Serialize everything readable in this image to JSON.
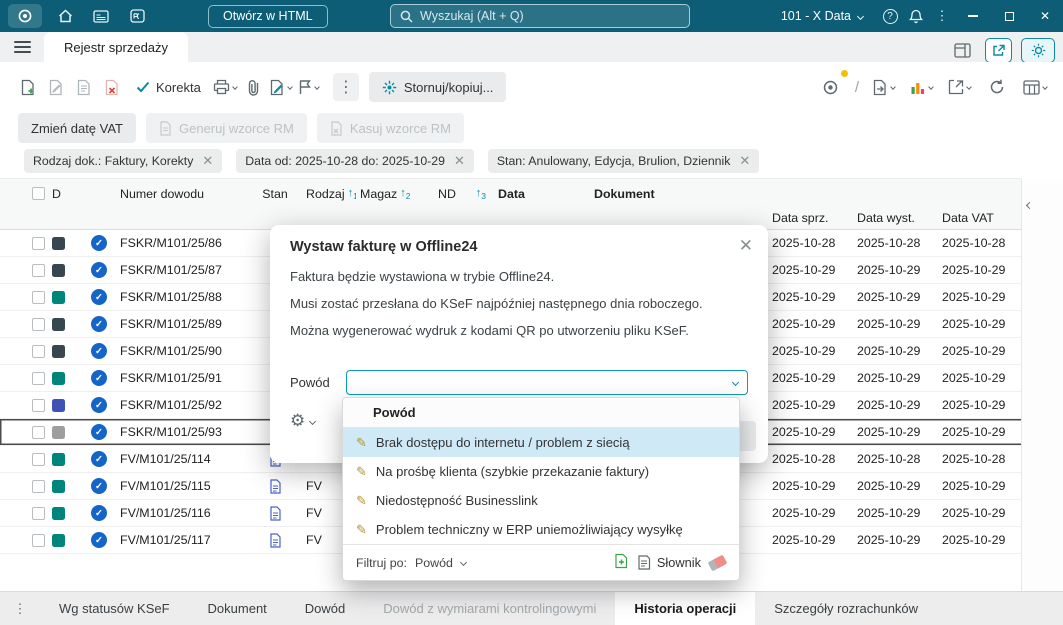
{
  "titlebar": {
    "open_html": "Otwórz w HTML",
    "search_placeholder": "Wyszukaj (Alt + Q)",
    "company": "101 - X Data"
  },
  "tabs": {
    "main": "Rejestr sprzedaży"
  },
  "toolbar": {
    "korekta": "Korekta",
    "stornuj": "Stornuj/kopiuj..."
  },
  "action_buttons": {
    "zmien_date_vat": "Zmień datę VAT",
    "generuj_wzorce": "Generuj wzorce RM",
    "kasuj_wzorce": "Kasuj wzorce RM"
  },
  "filter_chips": [
    {
      "text": "Rodzaj dok.: Faktury, Korekty"
    },
    {
      "text": "Data  od: 2025-10-28  do: 2025-10-29"
    },
    {
      "text": "Stan: Anulowany, Edycja, Brulion, Dziennik"
    }
  ],
  "table": {
    "headers": {
      "d": "D",
      "numer": "Numer dowodu",
      "stan": "Stan",
      "rodzaj": "Rodzaj",
      "magaz": "Magaz",
      "nd": "ND",
      "data": "Data",
      "dokument": "Dokument",
      "data_sprz": "Data sprz.",
      "data_wyst": "Data wyst.",
      "data_vat": "Data VAT",
      "sort1": "1",
      "sort2": "2",
      "sort3": "3"
    },
    "rows": [
      {
        "numer": "FSKR/M101/25/86",
        "d_color": "#37474f",
        "rodzaj": "",
        "data_sprz": "2025-10-28",
        "data_wyst": "2025-10-28",
        "data_vat": "2025-10-28"
      },
      {
        "numer": "FSKR/M101/25/87",
        "d_color": "#37474f",
        "rodzaj": "",
        "data_sprz": "2025-10-29",
        "data_wyst": "2025-10-29",
        "data_vat": "2025-10-29"
      },
      {
        "numer": "FSKR/M101/25/88",
        "d_color": "#00857c",
        "rodzaj": "",
        "data_sprz": "2025-10-29",
        "data_wyst": "2025-10-29",
        "data_vat": "2025-10-29"
      },
      {
        "numer": "FSKR/M101/25/89",
        "d_color": "#37474f",
        "rodzaj": "",
        "data_sprz": "2025-10-29",
        "data_wyst": "2025-10-29",
        "data_vat": "2025-10-29"
      },
      {
        "numer": "FSKR/M101/25/90",
        "d_color": "#37474f",
        "rodzaj": "",
        "data_sprz": "2025-10-29",
        "data_wyst": "2025-10-29",
        "data_vat": "2025-10-29"
      },
      {
        "numer": "FSKR/M101/25/91",
        "d_color": "#00857c",
        "rodzaj": "",
        "data_sprz": "2025-10-29",
        "data_wyst": "2025-10-29",
        "data_vat": "2025-10-29"
      },
      {
        "numer": "FSKR/M101/25/92",
        "d_color": "#4052b5",
        "rodzaj": "",
        "data_sprz": "2025-10-29",
        "data_wyst": "2025-10-29",
        "data_vat": "2025-10-29"
      },
      {
        "numer": "FSKR/M101/25/93",
        "d_color": "#9e9e9e",
        "rodzaj": "",
        "data_sprz": "2025-10-29",
        "data_wyst": "2025-10-29",
        "data_vat": "2025-10-29"
      },
      {
        "numer": "FV/M101/25/114",
        "d_color": "#00857c",
        "rodzaj": "FV",
        "data_sprz": "2025-10-28",
        "data_wyst": "2025-10-28",
        "data_vat": "2025-10-28"
      },
      {
        "numer": "FV/M101/25/115",
        "d_color": "#00857c",
        "rodzaj": "FV",
        "data_sprz": "2025-10-29",
        "data_wyst": "2025-10-29",
        "data_vat": "2025-10-29"
      },
      {
        "numer": "FV/M101/25/116",
        "d_color": "#00857c",
        "rodzaj": "FV",
        "data_sprz": "2025-10-29",
        "data_wyst": "2025-10-29",
        "data_vat": "2025-10-29"
      },
      {
        "numer": "FV/M101/25/117",
        "d_color": "#00857c",
        "rodzaj": "FV",
        "data_sprz": "2025-10-29",
        "data_wyst": "2025-10-29",
        "data_vat": "2025-10-29"
      }
    ]
  },
  "modal": {
    "title": "Wystaw fakturę w Offline24",
    "line1": "Faktura będzie wystawiona w trybie Offline24.",
    "line2": "Musi zostać przesłana do KSeF najpóźniej następnego dnia roboczego.",
    "line3": "Można wygenerować wydruk z kodami QR po utworzeniu pliku KSeF.",
    "powod_label": "Powód",
    "powod_value": ""
  },
  "dropdown": {
    "header": "Powód",
    "items": [
      {
        "label": "Brak dostępu do internetu / problem z siecią"
      },
      {
        "label": "Na prośbę klienta (szybkie przekazanie faktury)"
      },
      {
        "label": "Niedostępność Businesslink"
      },
      {
        "label": "Problem techniczny w ERP uniemożliwiający wysyłkę"
      }
    ],
    "footer": {
      "filtruj": "Filtruj po:",
      "filter_field": "Powód",
      "slownik": "Słownik"
    }
  },
  "bottom_tabs": [
    {
      "label": "Wg statusów KSeF"
    },
    {
      "label": "Dokument"
    },
    {
      "label": "Dowód"
    },
    {
      "label": "Dowód z wymiarami kontrolingowymi"
    },
    {
      "label": "Historia operacji"
    },
    {
      "label": "Szczegóły rozrachunków"
    }
  ],
  "colors": {
    "titlebar": "#0c5d75",
    "accent": "#0d8aa0",
    "ksef_check_circle": "#1565c8",
    "dropdown_selected_bg": "#cfe9f7",
    "selected_row_border": "#4b4b4b"
  }
}
